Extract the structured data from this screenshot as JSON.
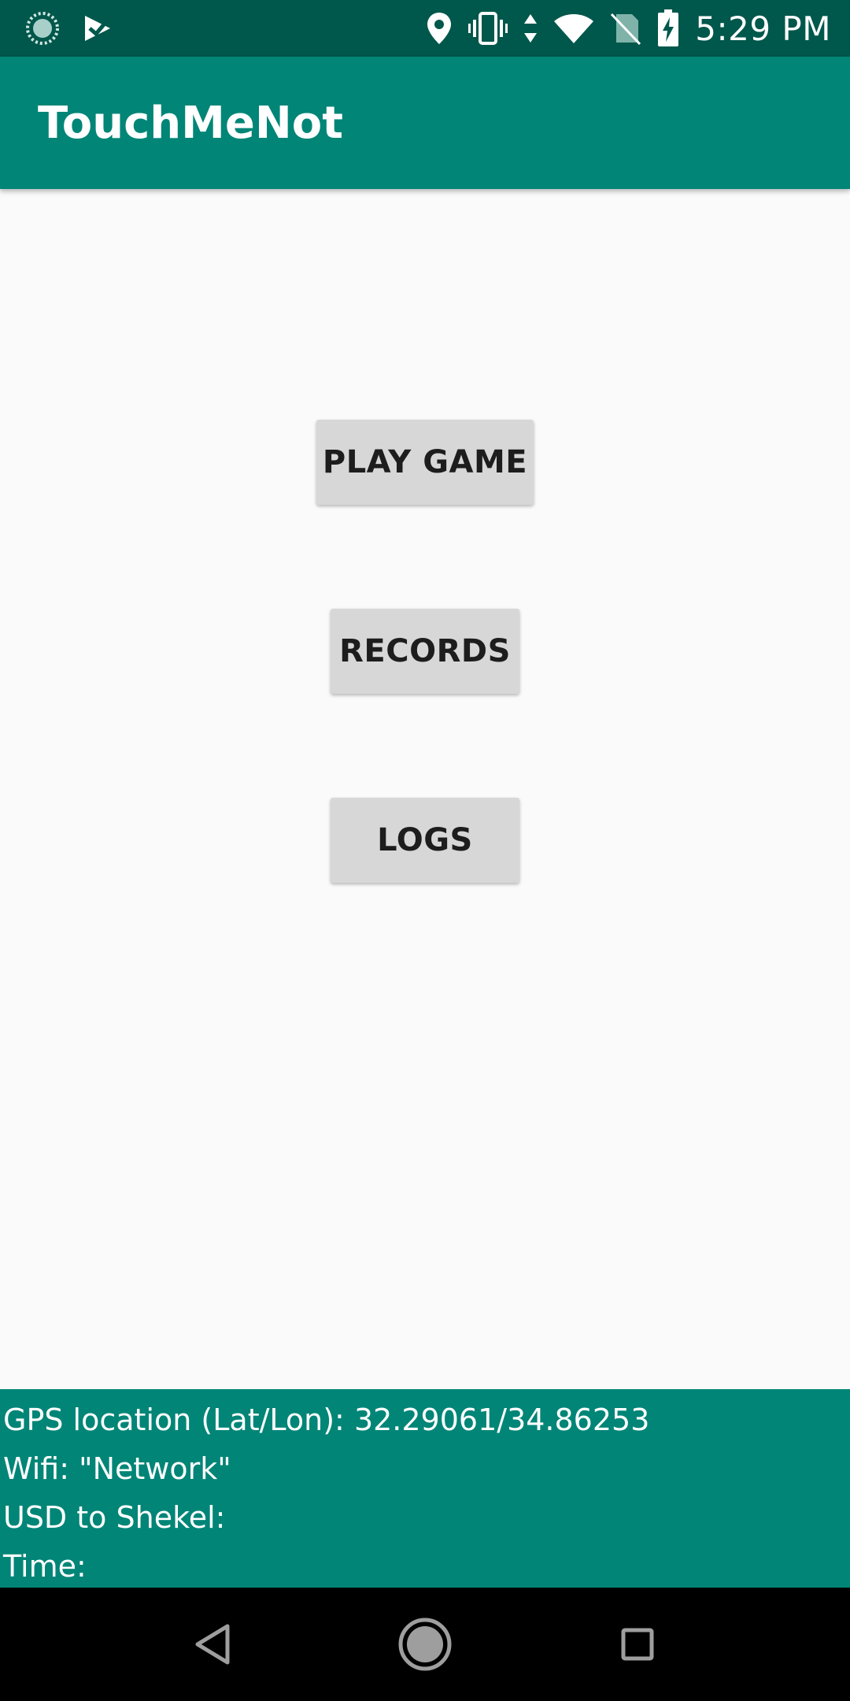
{
  "status_bar": {
    "time": "5:29 PM",
    "left_icons": [
      "loading-spinner-icon",
      "play-store-icon"
    ],
    "right_icons": [
      "location-icon",
      "vibrate-icon",
      "data-arrows-icon",
      "wifi-icon",
      "no-sim-icon",
      "battery-charging-icon"
    ]
  },
  "app_bar": {
    "title": "TouchMeNot"
  },
  "buttons": {
    "play": "PLAY GAME",
    "records": "RECORDS",
    "logs": "LOGS"
  },
  "info": {
    "gps": "GPS location (Lat/Lon): 32.29061/34.86253",
    "wifi": "Wifi: \"Network\"",
    "usd": "USD to Shekel:",
    "time": "Time:"
  },
  "nav_bar": {
    "icons": [
      "back-icon",
      "home-icon",
      "recents-icon"
    ]
  },
  "colors": {
    "status_bar": "#00574b",
    "primary": "#008577",
    "background": "#fafafa",
    "button": "#d7d7d7"
  }
}
